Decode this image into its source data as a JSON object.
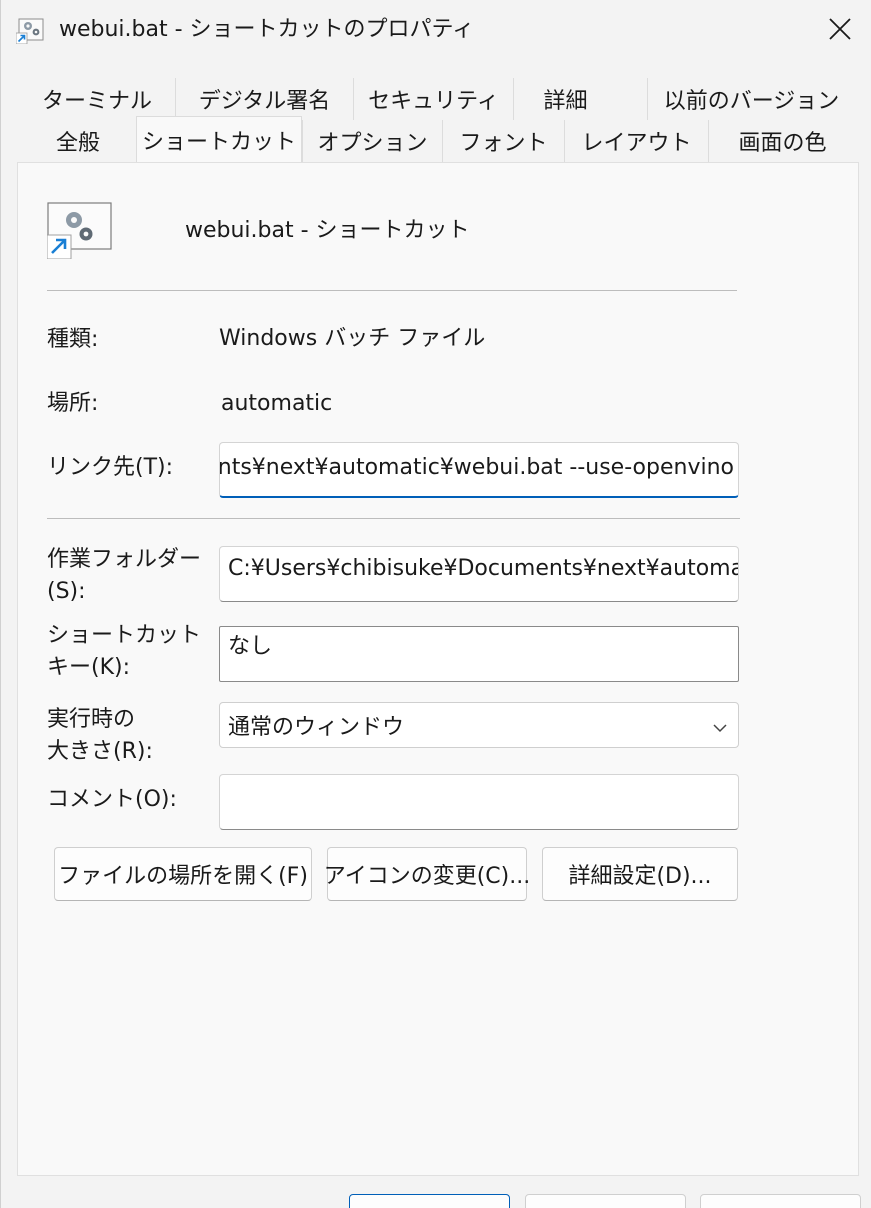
{
  "window": {
    "title": "webui.bat - ショートカットのプロパティ"
  },
  "tabs_row1": [
    {
      "label": "ターミナル"
    },
    {
      "label": "デジタル署名"
    },
    {
      "label": "セキュリティ"
    },
    {
      "label": "詳細"
    },
    {
      "label": "以前のバージョン"
    }
  ],
  "tabs_row2": [
    {
      "label": "全般"
    },
    {
      "label": "ショートカット",
      "active": true
    },
    {
      "label": "オプション"
    },
    {
      "label": "フォント"
    },
    {
      "label": "レイアウト"
    },
    {
      "label": "画面の色"
    }
  ],
  "shortcut": {
    "name": "webui.bat - ショートカット"
  },
  "fields": {
    "type_label": "種類:",
    "type_value": "Windows バッチ ファイル",
    "location_label": "場所:",
    "location_value": "automatic",
    "target_label": "リンク先(T):",
    "target_value": "ents¥next¥automatic¥webui.bat --use-openvino",
    "workdir_label_line1": "作業フォルダー",
    "workdir_label_line2": "(S):",
    "workdir_value": "C:¥Users¥chibisuke¥Documents¥next¥automatic",
    "hotkey_label_line1": "ショートカット",
    "hotkey_label_line2": "キー(K):",
    "hotkey_value": "なし",
    "runsize_label_line1": "実行時の",
    "runsize_label_line2": "大きさ(R):",
    "runsize_value": "通常のウィンドウ",
    "comment_label": "コメント(O):",
    "comment_value": ""
  },
  "buttons": {
    "open_location": "ファイルの場所を開く(F)",
    "change_icon": "アイコンの変更(C)...",
    "advanced": "詳細設定(D)..."
  },
  "colors": {
    "accent": "#005fb8",
    "arrow": "#1a7fd4"
  }
}
